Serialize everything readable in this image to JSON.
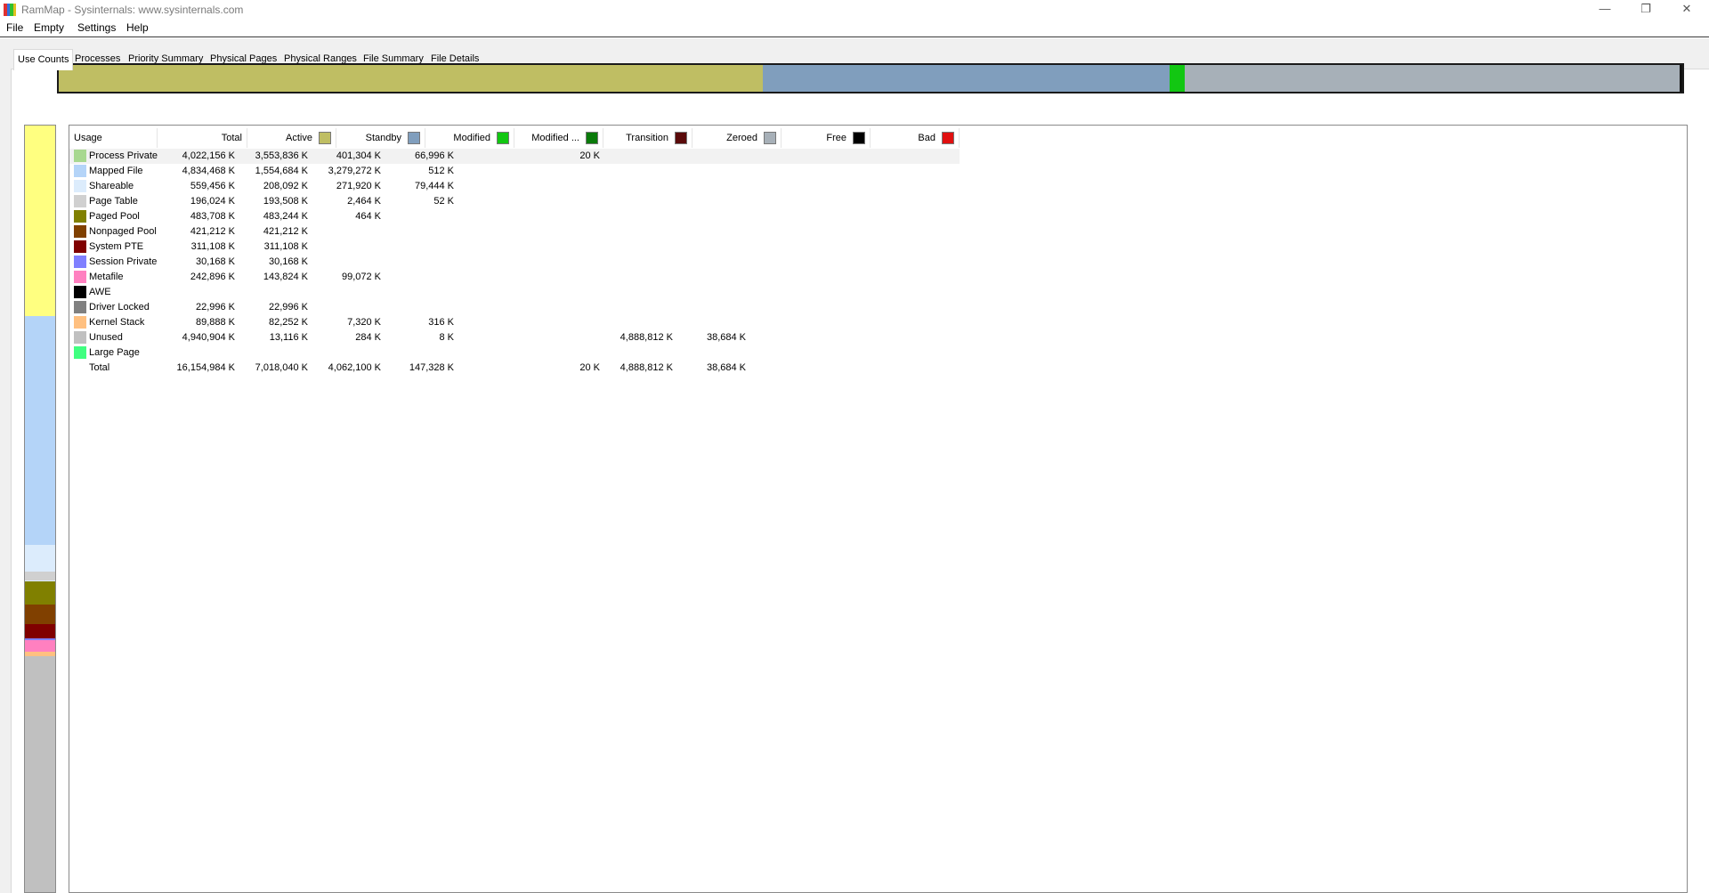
{
  "window": {
    "title": "RamMap - Sysinternals: www.sysinternals.com",
    "minimize": "—",
    "maximize": "❐",
    "close": "✕",
    "icon_colors": [
      "#e03030",
      "#3070e0",
      "#30c030",
      "#e0c020"
    ]
  },
  "menu": [
    "File",
    "Empty",
    "Settings",
    "Help"
  ],
  "tabs": [
    {
      "label": "Use Counts",
      "active": true
    },
    {
      "label": "Processes",
      "active": false
    },
    {
      "label": "Priority Summary",
      "active": false
    },
    {
      "label": "Physical Pages",
      "active": false
    },
    {
      "label": "Physical Ranges",
      "active": false
    },
    {
      "label": "File Summary",
      "active": false
    },
    {
      "label": "File Details",
      "active": false
    }
  ],
  "columns": [
    {
      "label": "Usage",
      "color": null
    },
    {
      "label": "Total",
      "color": null
    },
    {
      "label": "Active",
      "color": "#bfbe63"
    },
    {
      "label": "Standby",
      "color": "#809ebd"
    },
    {
      "label": "Modified",
      "color": "#12c712"
    },
    {
      "label": "Modified ...",
      "color": "#0a7a0a"
    },
    {
      "label": "Transition",
      "color": "#5a0a0a"
    },
    {
      "label": "Zeroed",
      "color": "#a7b0b8"
    },
    {
      "label": "Free",
      "color": "#000000"
    },
    {
      "label": "Bad",
      "color": "#e01010"
    }
  ],
  "rows": [
    {
      "usage": "Process Private",
      "color": "#a8d890",
      "total": "4,022,156 K",
      "active": "3,553,836 K",
      "standby": "401,304 K",
      "modified": "66,996 K",
      "modified_nw": "",
      "transition": "20 K",
      "zeroed": "",
      "free": "",
      "bad": "",
      "selected": true
    },
    {
      "usage": "Mapped File",
      "color": "#b4d4f8",
      "total": "4,834,468 K",
      "active": "1,554,684 K",
      "standby": "3,279,272 K",
      "modified": "512 K",
      "modified_nw": "",
      "transition": "",
      "zeroed": "",
      "free": "",
      "bad": ""
    },
    {
      "usage": "Shareable",
      "color": "#dcecfc",
      "total": "559,456 K",
      "active": "208,092 K",
      "standby": "271,920 K",
      "modified": "79,444 K",
      "modified_nw": "",
      "transition": "",
      "zeroed": "",
      "free": "",
      "bad": ""
    },
    {
      "usage": "Page Table",
      "color": "#d0d0d0",
      "total": "196,024 K",
      "active": "193,508 K",
      "standby": "2,464 K",
      "modified": "52 K",
      "modified_nw": "",
      "transition": "",
      "zeroed": "",
      "free": "",
      "bad": ""
    },
    {
      "usage": "Paged Pool",
      "color": "#808000",
      "total": "483,708 K",
      "active": "483,244 K",
      "standby": "464 K",
      "modified": "",
      "modified_nw": "",
      "transition": "",
      "zeroed": "",
      "free": "",
      "bad": ""
    },
    {
      "usage": "Nonpaged Pool",
      "color": "#804000",
      "total": "421,212 K",
      "active": "421,212 K",
      "standby": "",
      "modified": "",
      "modified_nw": "",
      "transition": "",
      "zeroed": "",
      "free": "",
      "bad": ""
    },
    {
      "usage": "System PTE",
      "color": "#800000",
      "total": "311,108 K",
      "active": "311,108 K",
      "standby": "",
      "modified": "",
      "modified_nw": "",
      "transition": "",
      "zeroed": "",
      "free": "",
      "bad": ""
    },
    {
      "usage": "Session Private",
      "color": "#8080ff",
      "total": "30,168 K",
      "active": "30,168 K",
      "standby": "",
      "modified": "",
      "modified_nw": "",
      "transition": "",
      "zeroed": "",
      "free": "",
      "bad": ""
    },
    {
      "usage": "Metafile",
      "color": "#ff80c0",
      "total": "242,896 K",
      "active": "143,824 K",
      "standby": "99,072 K",
      "modified": "",
      "modified_nw": "",
      "transition": "",
      "zeroed": "",
      "free": "",
      "bad": ""
    },
    {
      "usage": "AWE",
      "color": "#000000",
      "total": "",
      "active": "",
      "standby": "",
      "modified": "",
      "modified_nw": "",
      "transition": "",
      "zeroed": "",
      "free": "",
      "bad": ""
    },
    {
      "usage": "Driver Locked",
      "color": "#808080",
      "total": "22,996 K",
      "active": "22,996 K",
      "standby": "",
      "modified": "",
      "modified_nw": "",
      "transition": "",
      "zeroed": "",
      "free": "",
      "bad": ""
    },
    {
      "usage": "Kernel Stack",
      "color": "#ffc080",
      "total": "89,888 K",
      "active": "82,252 K",
      "standby": "7,320 K",
      "modified": "316 K",
      "modified_nw": "",
      "transition": "",
      "zeroed": "",
      "free": "",
      "bad": ""
    },
    {
      "usage": "Unused",
      "color": "#c0c0c0",
      "total": "4,940,904 K",
      "active": "13,116 K",
      "standby": "284 K",
      "modified": "8 K",
      "modified_nw": "",
      "transition": "",
      "zeroed": "4,888,812 K",
      "free": "38,684 K",
      "bad": ""
    },
    {
      "usage": "Large Page",
      "color": "#40ff80",
      "total": "",
      "active": "",
      "standby": "",
      "modified": "",
      "modified_nw": "",
      "transition": "",
      "zeroed": "",
      "free": "",
      "bad": ""
    },
    {
      "usage": "Total",
      "color": null,
      "total": "16,154,984 K",
      "active": "7,018,040 K",
      "standby": "4,062,100 K",
      "modified": "147,328 K",
      "modified_nw": "",
      "transition": "20 K",
      "zeroed": "4,888,812 K",
      "free": "38,684 K",
      "bad": ""
    }
  ],
  "vertical_bar": [
    {
      "name": "process-private",
      "color": "#ffff80",
      "fraction": 0.249
    },
    {
      "name": "mapped-file",
      "color": "#b4d4f8",
      "fraction": 0.299
    },
    {
      "name": "shareable",
      "color": "#dcecfc",
      "fraction": 0.035
    },
    {
      "name": "page-table",
      "color": "#d0d0d0",
      "fraction": 0.012
    },
    {
      "name": "shareable-2",
      "color": "#dcecfc",
      "fraction": 0.001
    },
    {
      "name": "paged-pool",
      "color": "#808000",
      "fraction": 0.03
    },
    {
      "name": "nonpaged-pool",
      "color": "#804000",
      "fraction": 0.026
    },
    {
      "name": "system-pte",
      "color": "#800000",
      "fraction": 0.019
    },
    {
      "name": "session-private",
      "color": "#8080ff",
      "fraction": 0.002
    },
    {
      "name": "metafile",
      "color": "#ff80c0",
      "fraction": 0.015
    },
    {
      "name": "kernel-stack",
      "color": "#ffc080",
      "fraction": 0.006
    },
    {
      "name": "unused",
      "color": "#c0c0c0",
      "fraction": 0.306
    }
  ]
}
